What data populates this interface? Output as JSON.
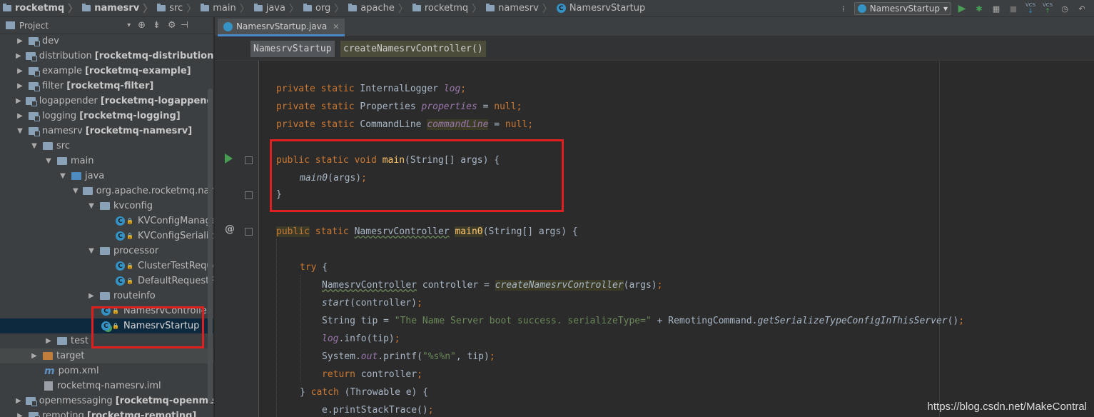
{
  "breadcrumbs": [
    "rocketmq",
    "namesrv",
    "src",
    "main",
    "java",
    "org",
    "apache",
    "rocketmq",
    "namesrv",
    "NamesrvStartup"
  ],
  "toolbar": {
    "run_config": "NamesrvStartup",
    "icons": [
      "binary-icon",
      "run-icon",
      "debug-icon",
      "coverage-icon",
      "stop-icon",
      "vcs-update-icon",
      "vcs-commit-icon",
      "history-icon",
      "revert-icon"
    ],
    "vcs_label": "VCS"
  },
  "project_panel": {
    "title": "Project",
    "tree": [
      {
        "label": "dev",
        "module": ""
      },
      {
        "label": "distribution",
        "module": "[rocketmq-distribution]"
      },
      {
        "label": "example",
        "module": "[rocketmq-example]"
      },
      {
        "label": "filter",
        "module": "[rocketmq-filter]"
      },
      {
        "label": "logappender",
        "module": "[rocketmq-logappender]"
      },
      {
        "label": "logging",
        "module": "[rocketmq-logging]"
      },
      {
        "label": "namesrv",
        "module": "[rocketmq-namesrv]"
      },
      {
        "label": "src"
      },
      {
        "label": "main"
      },
      {
        "label": "java"
      },
      {
        "label": "org.apache.rocketmq.name"
      },
      {
        "label": "kvconfig"
      },
      {
        "label": "KVConfigManage"
      },
      {
        "label": "KVConfigSerialize"
      },
      {
        "label": "processor"
      },
      {
        "label": "ClusterTestReque"
      },
      {
        "label": "DefaultRequestPro"
      },
      {
        "label": "routeinfo"
      },
      {
        "label": "NamesrvController"
      },
      {
        "label": "NamesrvStartup"
      },
      {
        "label": "test"
      },
      {
        "label": "target"
      },
      {
        "label": "pom.xml"
      },
      {
        "label": "rocketmq-namesrv.iml"
      },
      {
        "label": "openmessaging",
        "module": "[rocketmq-openmessag"
      },
      {
        "label": "remoting",
        "module": "[rocketmq-remoting]"
      }
    ]
  },
  "editor": {
    "tab": "NamesrvStartup.java",
    "breadcrumb_class": "NamesrvStartup",
    "breadcrumb_method": "createNamesrvController()"
  },
  "code": {
    "l1": {
      "a": "private static ",
      "b": "InternalLogger ",
      "c": "log",
      "d": ";"
    },
    "l2": {
      "a": "private static ",
      "b": "Properties ",
      "c": "properties",
      "d": " = ",
      "e": "null",
      "f": ";"
    },
    "l3": {
      "a": "private static ",
      "b": "CommandLine ",
      "c": "commandLine",
      "d": " = ",
      "e": "null",
      "f": ";"
    },
    "l4": {
      "a": "public static void ",
      "b": "main",
      "c": "(String[] args) {"
    },
    "l5": {
      "a": "main0",
      "b": "(args)",
      "c": ";"
    },
    "l6": {
      "a": "}"
    },
    "l7": {
      "a": "public",
      "b": " static ",
      "c": "NamesrvController",
      "d": " ",
      "e": "main0",
      "f": "(String[] args) {"
    },
    "l8": {
      "a": "try",
      "b": " {"
    },
    "l9": {
      "a": "NamesrvController",
      "b": " controller = ",
      "c": "createNamesrvController",
      "d": "(args)",
      "e": ";"
    },
    "l10": {
      "a": "start",
      "b": "(controller)",
      "c": ";"
    },
    "l11": {
      "a": "String tip = ",
      "b": "\"The Name Server boot success. serializeType=\"",
      "c": " + RemotingCommand.",
      "d": "getSerializeTypeConfigInThisServer",
      "e": "()",
      "f": ";"
    },
    "l12": {
      "a": "log",
      "b": ".info(tip)",
      "c": ";"
    },
    "l13": {
      "a": "System.",
      "b": "out",
      "c": ".printf(",
      "d": "\"%s%n\"",
      "e": ", tip)",
      "f": ";"
    },
    "l14": {
      "a": "return ",
      "b": "controller",
      "c": ";"
    },
    "l15": {
      "a": "} ",
      "b": "catch",
      "c": " (Throwable e) {"
    },
    "l16": {
      "a": "e.printStackTrace()",
      "b": ";"
    }
  },
  "watermark": "https://blog.csdn.net/MakeContral"
}
